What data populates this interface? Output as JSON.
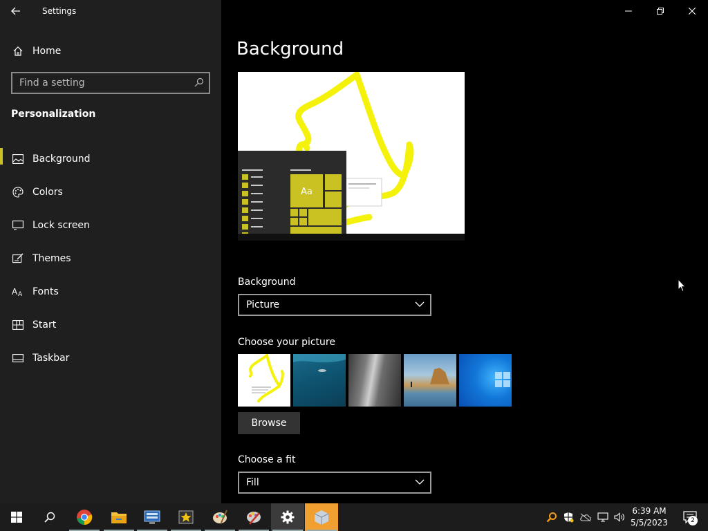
{
  "window": {
    "title": "Settings"
  },
  "sidebar": {
    "home_label": "Home",
    "search_placeholder": "Find a setting",
    "section_title": "Personalization",
    "items": [
      {
        "label": "Background",
        "icon": "picture-icon",
        "active": true
      },
      {
        "label": "Colors",
        "icon": "palette-icon"
      },
      {
        "label": "Lock screen",
        "icon": "lock-screen-icon"
      },
      {
        "label": "Themes",
        "icon": "themes-icon"
      },
      {
        "label": "Fonts",
        "icon": "fonts-icon"
      },
      {
        "label": "Start",
        "icon": "start-icon"
      },
      {
        "label": "Taskbar",
        "icon": "taskbar-icon"
      }
    ]
  },
  "main": {
    "title": "Background",
    "preview": {
      "tile_label": "Aa"
    },
    "background_label": "Background",
    "background_value": "Picture",
    "choose_picture_label": "Choose your picture",
    "browse_label": "Browse",
    "fit_label": "Choose a fit",
    "fit_value": "Fill"
  },
  "taskbar": {
    "time": "6:39 AM",
    "date": "5/5/2023",
    "notification_count": "2",
    "apps": [
      "start",
      "search",
      "chrome",
      "file-explorer",
      "remote-desktop",
      "movie-maker",
      "paint",
      "paint-alt",
      "settings",
      "package"
    ]
  },
  "colors": {
    "accent": "#c9c222",
    "sidebar_bg": "#1f1f1f",
    "main_bg": "#000000"
  }
}
